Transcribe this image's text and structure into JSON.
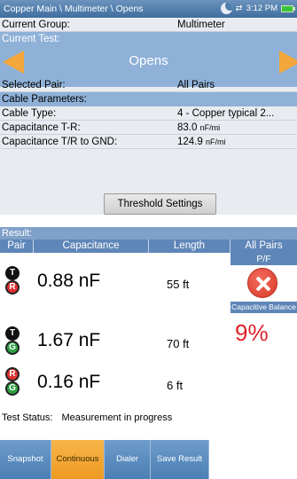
{
  "titlebar": {
    "path": "Copper Main \\ Multimeter \\ Opens",
    "time": "3:12 PM"
  },
  "params": {
    "current_group_label": "Current Group:",
    "current_group_value": "Multimeter",
    "current_test_label": "Current Test:",
    "current_test_value": "Opens",
    "selected_pair_label": "Selected Pair:",
    "selected_pair_value": "All Pairs",
    "cable_params_label": "Cable Parameters:",
    "cable_type_label": "Cable Type:",
    "cable_type_value": "4 - Copper typical 2...",
    "cap_tr_label": "Capacitance T-R:",
    "cap_tr_value": "83.0",
    "cap_tr_unit": "nF/mi",
    "cap_gnd_label": "Capacitance T/R to GND:",
    "cap_gnd_value": "124.9",
    "cap_gnd_unit": "nF/mi",
    "threshold_button": "Threshold Settings"
  },
  "result": {
    "header": "Result:",
    "columns": [
      "Pair",
      "Capacitance",
      "Length",
      "All Pairs"
    ],
    "pf_label": "P/F",
    "rows": [
      {
        "pair_a": "T",
        "pair_b": "R",
        "capacitance": "0.88 nF",
        "length": "55 ft"
      },
      {
        "pair_a": "T",
        "pair_b": "G",
        "capacitance": "1.67 nF",
        "length": "70 ft"
      },
      {
        "pair_a": "R",
        "pair_b": "G",
        "capacitance": "0.16 nF",
        "length": "6 ft"
      }
    ],
    "capacitive_balance_label": "Capacitive Balance",
    "capacitive_balance_value": "9%",
    "fail_icon": "fail-x-icon"
  },
  "status": {
    "label": "Test Status:",
    "value": "Measurement in progress"
  },
  "toolbar": [
    "Snapshot",
    "Continuous",
    "Dialer",
    "Save Result"
  ],
  "colors": {
    "accent": "#f3a73a",
    "header_blue": "#5f86b8",
    "fail_red": "#e0202a"
  }
}
